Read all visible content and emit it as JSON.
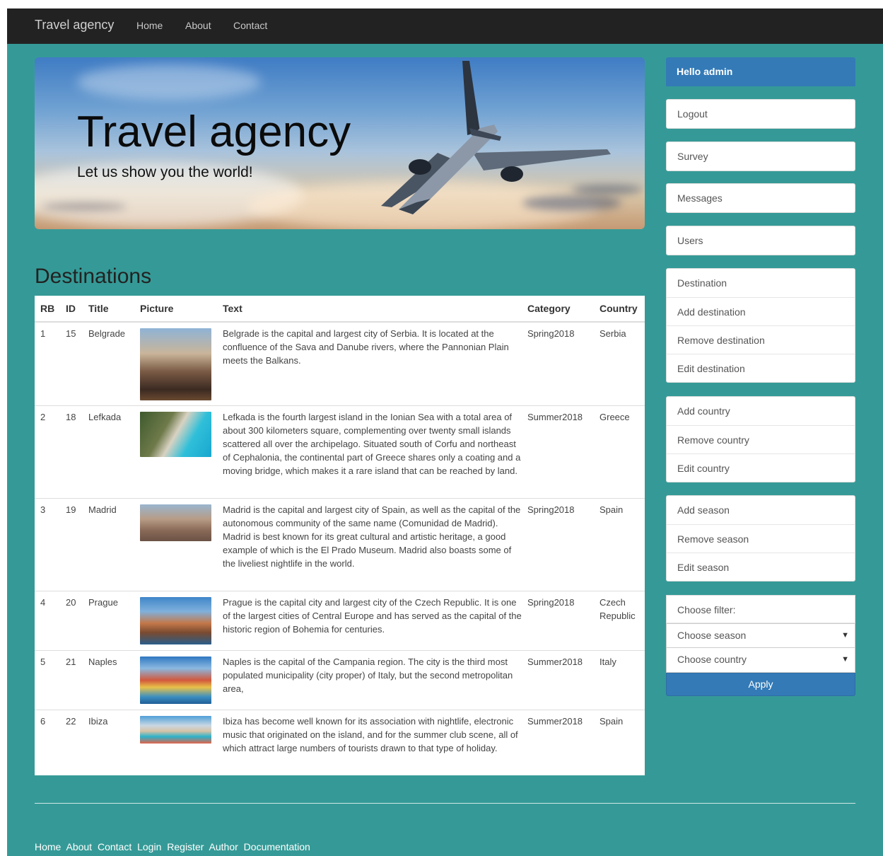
{
  "navbar": {
    "brand": "Travel agency",
    "links": [
      "Home",
      "About",
      "Contact"
    ]
  },
  "hero": {
    "title": "Travel agency",
    "subtitle": "Let us show you the world!"
  },
  "destinations": {
    "heading": "Destinations",
    "columns": [
      "RB",
      "ID",
      "Title",
      "Picture",
      "Text",
      "Category",
      "Country"
    ],
    "rows": [
      {
        "rb": "1",
        "id": "15",
        "title": "Belgrade",
        "picture": "belgrade-photo",
        "text": "Belgrade is the capital and largest city of Serbia. It is located at the confluence of the Sava and Danube rivers, where the Pannonian Plain meets the Balkans.",
        "category": "Spring2018",
        "country": "Serbia"
      },
      {
        "rb": "2",
        "id": "18",
        "title": "Lefkada",
        "picture": "lefkada-photo",
        "text": "Lefkada is the fourth largest island in the Ionian Sea with a total area of about 300 kilometers square, complementing over twenty small islands scattered all over the archipelago. Situated south of Corfu and northeast of Cephalonia, the continental part of Greece shares only a coating and a moving bridge, which makes it a rare island that can be reached by land.",
        "category": "Summer2018",
        "country": "Greece"
      },
      {
        "rb": "3",
        "id": "19",
        "title": "Madrid",
        "picture": "madrid-photo",
        "text": "Madrid is the capital and largest city of Spain, as well as the capital of the autonomous community of the same name (Comunidad de Madrid). Madrid is best known for its great cultural and artistic heritage, a good example of which is the El Prado Museum. Madrid also boasts some of the liveliest nightlife in the world.",
        "category": "Spring2018",
        "country": "Spain"
      },
      {
        "rb": "4",
        "id": "20",
        "title": "Prague",
        "picture": "prague-photo",
        "text": "Prague is the capital city and largest city of the Czech Republic. It is one of the largest cities of Central Europe and has served as the capital of the historic region of Bohemia for centuries.",
        "category": "Spring2018",
        "country": "Czech Republic"
      },
      {
        "rb": "5",
        "id": "21",
        "title": "Naples",
        "picture": "naples-photo",
        "text": "Naples is the capital of the Campania region. The city is the third most populated municipality (city proper) of Italy, but the second metropolitan area,",
        "category": "Summer2018",
        "country": "Italy"
      },
      {
        "rb": "6",
        "id": "22",
        "title": "Ibiza",
        "picture": "ibiza-photo",
        "text": "Ibiza has become well known for its association with nightlife, electronic music that originated on the island, and for the summer club scene, all of which attract large numbers of tourists drawn to that type of holiday.",
        "category": "Summer2018",
        "country": "Spain"
      }
    ]
  },
  "sidebar": {
    "hello": "Hello admin",
    "logout": "Logout",
    "survey": "Survey",
    "messages": "Messages",
    "users": "Users",
    "destination_group": [
      "Destination",
      "Add destination",
      "Remove destination",
      "Edit destination"
    ],
    "country_group": [
      "Add country",
      "Remove country",
      "Edit country"
    ],
    "season_group": [
      "Add season",
      "Remove season",
      "Edit season"
    ],
    "filter": {
      "label": "Choose filter:",
      "season_placeholder": "Choose season",
      "country_placeholder": "Choose country",
      "apply": "Apply"
    }
  },
  "footer": {
    "links": [
      "Home",
      "About",
      "Contact",
      "Login",
      "Register",
      "Author",
      "Documentation"
    ]
  },
  "colors": {
    "page_bg": "#359a97",
    "navbar_bg": "#222222",
    "primary": "#337ab7"
  }
}
